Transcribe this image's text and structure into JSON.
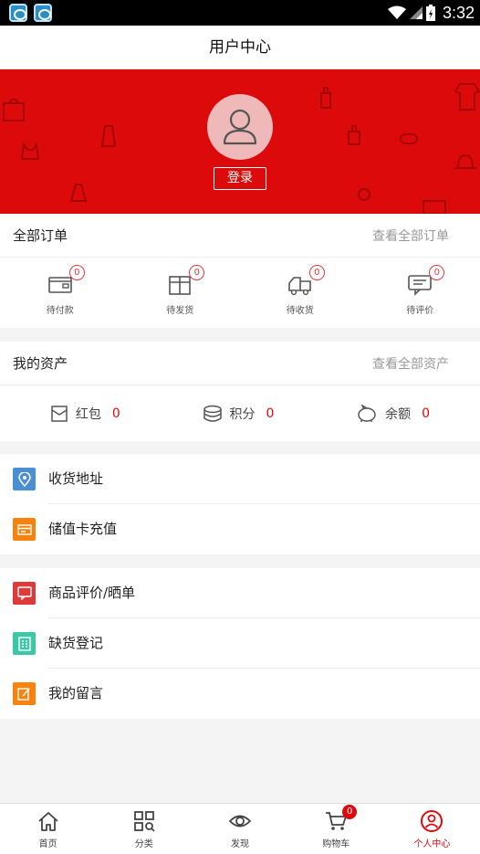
{
  "status_bar": {
    "time": "3:32"
  },
  "header": {
    "title": "用户中心"
  },
  "profile": {
    "login_label": "登录"
  },
  "orders": {
    "title": "全部订单",
    "view_all": "查看全部订单",
    "items": [
      {
        "label": "待付款",
        "count": "0",
        "icon": "wallet-icon"
      },
      {
        "label": "待发货",
        "count": "0",
        "icon": "box-icon"
      },
      {
        "label": "待收货",
        "count": "0",
        "icon": "truck-icon"
      },
      {
        "label": "待评价",
        "count": "0",
        "icon": "comment-icon"
      }
    ]
  },
  "assets": {
    "title": "我的资产",
    "view_all": "查看全部资产",
    "items": [
      {
        "label": "红包",
        "value": "0",
        "icon": "red-packet-icon"
      },
      {
        "label": "积分",
        "value": "0",
        "icon": "coins-icon"
      },
      {
        "label": "余额",
        "value": "0",
        "icon": "piggy-bank-icon"
      }
    ]
  },
  "menu_groups": [
    [
      {
        "label": "收货地址",
        "icon": "location-icon",
        "color": "#4a8fd2"
      },
      {
        "label": "储值卡充值",
        "icon": "card-icon",
        "color": "#f7830e"
      }
    ],
    [
      {
        "label": "商品评价/晒单",
        "icon": "review-icon",
        "color": "#dd3a3a"
      },
      {
        "label": "缺货登记",
        "icon": "register-icon",
        "color": "#3cc8a8"
      },
      {
        "label": "我的留言",
        "icon": "message-icon",
        "color": "#f7830e"
      }
    ]
  ],
  "tabbar": {
    "cart_count": "0",
    "items": [
      {
        "label": "首页",
        "icon": "home-icon"
      },
      {
        "label": "分类",
        "icon": "category-icon"
      },
      {
        "label": "发现",
        "icon": "eye-icon"
      },
      {
        "label": "购物车",
        "icon": "cart-icon"
      },
      {
        "label": "个人中心",
        "icon": "user-icon"
      }
    ]
  },
  "colors": {
    "brand": "#dc0a0a",
    "badge": "#e23b3b"
  }
}
